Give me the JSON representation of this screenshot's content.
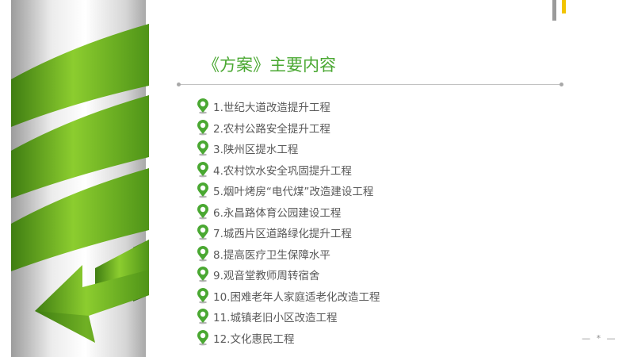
{
  "slide": {
    "title": "《方案》主要内容",
    "items": [
      "1.世纪大道改造提升工程",
      "2.农村公路安全提升工程",
      "3.陕州区提水工程",
      "4.农村饮水安全巩固提升工程",
      "5.烟叶烤房“电代煤”改造建设工程",
      "6.永昌路体育公园建设工程",
      "7.城西片区道路绿化提升工程",
      "8.提高医疗卫生保障水平",
      "9.观音堂教师周转宿舍",
      "10.困难老年人家庭适老化改造工程",
      "11.城镇老旧小区改造工程",
      "12.文化惠民工程"
    ],
    "bullet_icon": "location-pin-icon",
    "page_number": "— * —"
  },
  "colors": {
    "accent_green": "#4aa832",
    "ribbon_green": "#6ab82a",
    "text_gray": "#595959",
    "accent_yellow": "#f2c400"
  }
}
